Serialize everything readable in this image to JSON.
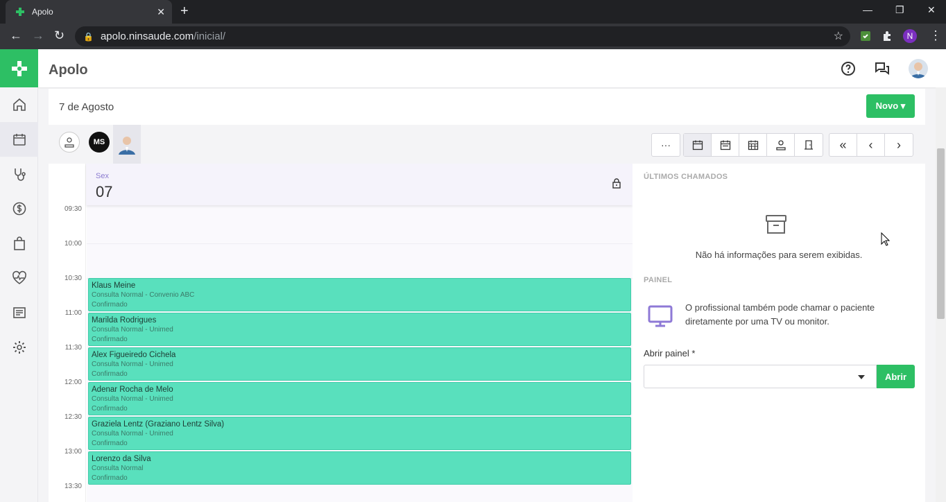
{
  "browser": {
    "tab_title": "Apolo",
    "url_host": "apolo.ninsaude.com",
    "url_path": "/inicial/",
    "profile_initial": "N"
  },
  "app": {
    "title": "Apolo",
    "brand_color": "#2dbf64"
  },
  "sidebar": {
    "items": [
      {
        "name": "home-icon"
      },
      {
        "name": "calendar-icon"
      },
      {
        "name": "stethoscope-icon"
      },
      {
        "name": "dollar-icon"
      },
      {
        "name": "shopping-bag-icon"
      },
      {
        "name": "heart-pulse-icon"
      },
      {
        "name": "document-icon"
      },
      {
        "name": "gear-icon"
      }
    ],
    "active": "calendar-icon"
  },
  "toolbar": {
    "date_title": "7 de Agosto",
    "novo_label": "Novo"
  },
  "professionals": {
    "ms_initials": "MS"
  },
  "calendar": {
    "day_of_week": "Sex",
    "day_number": "07",
    "times": [
      "09:30",
      "10:00",
      "10:30",
      "11:00",
      "11:30",
      "12:00",
      "12:30",
      "13:00",
      "13:30"
    ],
    "appointments": [
      {
        "patient": "Klaus Meine",
        "type": "Consulta Normal - Convenio ABC",
        "status": "Confirmado"
      },
      {
        "patient": "Marilda Rodrigues",
        "type": "Consulta Normal - Unimed",
        "status": "Confirmado"
      },
      {
        "patient": "Alex Figueiredo Cichela",
        "type": "Consulta Normal - Unimed",
        "status": "Confirmado"
      },
      {
        "patient": "Adenar Rocha de Melo",
        "type": "Consulta Normal - Unimed",
        "status": "Confirmado"
      },
      {
        "patient": "Graziela Lentz (Graziano Lentz Silva)",
        "type": "Consulta Normal - Unimed",
        "status": "Confirmado"
      },
      {
        "patient": "Lorenzo da Silva",
        "type": "Consulta Normal",
        "status": "Confirmado"
      }
    ],
    "appointment_color": "#59e0bd"
  },
  "right_panel": {
    "last_calls_heading": "ÚLTIMOS CHAMADOS",
    "empty_message": "Não há informações para serem exibidas.",
    "panel_heading": "PAINEL",
    "panel_description": "O profissional também pode chamar o paciente diretamente por uma TV ou monitor.",
    "open_panel_label": "Abrir painel *",
    "open_button": "Abrir"
  }
}
